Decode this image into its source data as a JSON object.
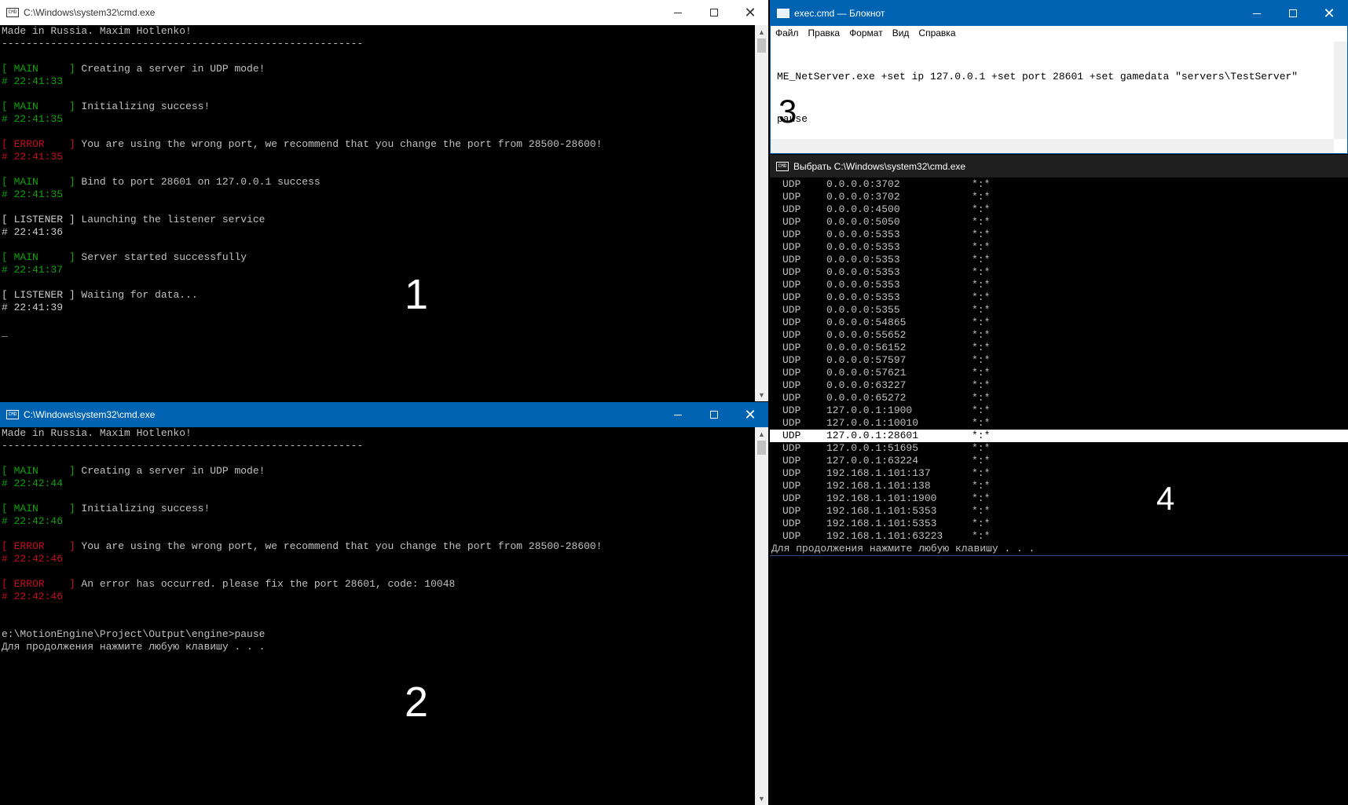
{
  "win1": {
    "title": "C:\\Windows\\system32\\cmd.exe",
    "label": "1",
    "lines": [
      {
        "type": "plain",
        "text": "Made in Russia. Maxim Hotlenko!"
      },
      {
        "type": "plain",
        "text": "-----------------------------------------------------------"
      },
      {
        "type": "blank"
      },
      {
        "type": "tag",
        "tag": "MAIN",
        "color": "green",
        "msg": "Creating a server in UDP mode!"
      },
      {
        "type": "time",
        "color": "green",
        "text": "# 22:41:33"
      },
      {
        "type": "blank"
      },
      {
        "type": "tag",
        "tag": "MAIN",
        "color": "green",
        "msg": "Initializing success!"
      },
      {
        "type": "time",
        "color": "green",
        "text": "# 22:41:35"
      },
      {
        "type": "blank"
      },
      {
        "type": "tag",
        "tag": "ERROR",
        "color": "red",
        "msg": "You are using the wrong port, we recommend that you change the port from 28500-28600!"
      },
      {
        "type": "time",
        "color": "red",
        "text": "# 22:41:35"
      },
      {
        "type": "blank"
      },
      {
        "type": "tag",
        "tag": "MAIN",
        "color": "green",
        "msg": "Bind to port 28601 on 127.0.0.1 success"
      },
      {
        "type": "time",
        "color": "green",
        "text": "# 22:41:35"
      },
      {
        "type": "blank"
      },
      {
        "type": "tag",
        "tag": "LISTENER",
        "color": "bright",
        "msg": "Launching the listener service"
      },
      {
        "type": "time",
        "color": "bright",
        "text": "# 22:41:36"
      },
      {
        "type": "blank"
      },
      {
        "type": "tag",
        "tag": "MAIN",
        "color": "green",
        "msg": "Server started successfully"
      },
      {
        "type": "time",
        "color": "green",
        "text": "# 22:41:37"
      },
      {
        "type": "blank"
      },
      {
        "type": "tag",
        "tag": "LISTENER",
        "color": "bright",
        "msg": "Waiting for data..."
      },
      {
        "type": "time",
        "color": "bright",
        "text": "# 22:41:39"
      },
      {
        "type": "blank"
      },
      {
        "type": "plain",
        "text": "_"
      }
    ]
  },
  "win2": {
    "title": "C:\\Windows\\system32\\cmd.exe",
    "label": "2",
    "lines": [
      {
        "type": "plain",
        "text": "Made in Russia. Maxim Hotlenko!"
      },
      {
        "type": "plain",
        "text": "-----------------------------------------------------------"
      },
      {
        "type": "blank"
      },
      {
        "type": "tag",
        "tag": "MAIN",
        "color": "green",
        "msg": "Creating a server in UDP mode!"
      },
      {
        "type": "time",
        "color": "green",
        "text": "# 22:42:44"
      },
      {
        "type": "blank"
      },
      {
        "type": "tag",
        "tag": "MAIN",
        "color": "green",
        "msg": "Initializing success!"
      },
      {
        "type": "time",
        "color": "green",
        "text": "# 22:42:46"
      },
      {
        "type": "blank"
      },
      {
        "type": "tag",
        "tag": "ERROR",
        "color": "red",
        "msg": "You are using the wrong port, we recommend that you change the port from 28500-28600!"
      },
      {
        "type": "time",
        "color": "red",
        "text": "# 22:42:46"
      },
      {
        "type": "blank"
      },
      {
        "type": "tag",
        "tag": "ERROR",
        "color": "red",
        "msg": "An error has occurred. please fix the port 28601, code: 10048"
      },
      {
        "type": "time",
        "color": "red",
        "text": "# 22:42:46"
      },
      {
        "type": "blank"
      },
      {
        "type": "blank"
      },
      {
        "type": "plain",
        "text": "e:\\MotionEngine\\Project\\Output\\engine>pause"
      },
      {
        "type": "plain",
        "text": "Для продолжения нажмите любую клавишу . . ."
      }
    ]
  },
  "win3": {
    "title": "exec.cmd — Блокнот",
    "label": "3",
    "menu": [
      "Файл",
      "Правка",
      "Формат",
      "Вид",
      "Справка"
    ],
    "text_lines": [
      "ME_NetServer.exe +set ip 127.0.0.1 +set port 28601 +set gamedata \"servers\\TestServer\"",
      "pause"
    ]
  },
  "win4": {
    "title": "Выбрать C:\\Windows\\system32\\cmd.exe",
    "label": "4",
    "selected_index": 20,
    "rows": [
      [
        "UDP",
        "0.0.0.0:3702",
        "*:*"
      ],
      [
        "UDP",
        "0.0.0.0:3702",
        "*:*"
      ],
      [
        "UDP",
        "0.0.0.0:4500",
        "*:*"
      ],
      [
        "UDP",
        "0.0.0.0:5050",
        "*:*"
      ],
      [
        "UDP",
        "0.0.0.0:5353",
        "*:*"
      ],
      [
        "UDP",
        "0.0.0.0:5353",
        "*:*"
      ],
      [
        "UDP",
        "0.0.0.0:5353",
        "*:*"
      ],
      [
        "UDP",
        "0.0.0.0:5353",
        "*:*"
      ],
      [
        "UDP",
        "0.0.0.0:5353",
        "*:*"
      ],
      [
        "UDP",
        "0.0.0.0:5353",
        "*:*"
      ],
      [
        "UDP",
        "0.0.0.0:5355",
        "*:*"
      ],
      [
        "UDP",
        "0.0.0.0:54865",
        "*:*"
      ],
      [
        "UDP",
        "0.0.0.0:55652",
        "*:*"
      ],
      [
        "UDP",
        "0.0.0.0:56152",
        "*:*"
      ],
      [
        "UDP",
        "0.0.0.0:57597",
        "*:*"
      ],
      [
        "UDP",
        "0.0.0.0:57621",
        "*:*"
      ],
      [
        "UDP",
        "0.0.0.0:63227",
        "*:*"
      ],
      [
        "UDP",
        "0.0.0.0:65272",
        "*:*"
      ],
      [
        "UDP",
        "127.0.0.1:1900",
        "*:*"
      ],
      [
        "UDP",
        "127.0.0.1:10010",
        "*:*"
      ],
      [
        "UDP",
        "127.0.0.1:28601",
        "*:*"
      ],
      [
        "UDP",
        "127.0.0.1:51695",
        "*:*"
      ],
      [
        "UDP",
        "127.0.0.1:63224",
        "*:*"
      ],
      [
        "UDP",
        "192.168.1.101:137",
        "*:*"
      ],
      [
        "UDP",
        "192.168.1.101:138",
        "*:*"
      ],
      [
        "UDP",
        "192.168.1.101:1900",
        "*:*"
      ],
      [
        "UDP",
        "192.168.1.101:5353",
        "*:*"
      ],
      [
        "UDP",
        "192.168.1.101:5353",
        "*:*"
      ],
      [
        "UDP",
        "192.168.1.101:63223",
        "*:*"
      ]
    ],
    "footer": "Для продолжения нажмите любую клавишу . . ."
  },
  "icons": {
    "cmd": "CMD",
    "minimize": "minimize-icon",
    "maximize": "maximize-icon",
    "close": "✕"
  },
  "colors": {
    "active_title": "#0063b1",
    "green": "#13a10e",
    "red": "#c50f1f"
  }
}
